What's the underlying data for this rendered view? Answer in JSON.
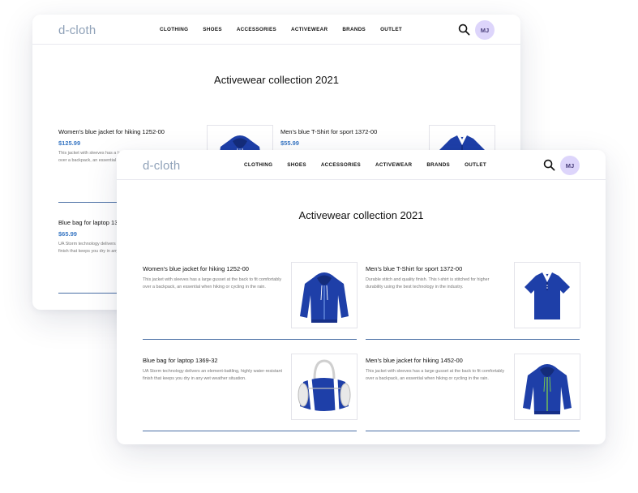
{
  "brand": {
    "logo": "d-cloth"
  },
  "nav": {
    "items": [
      "CLOTHING",
      "SHOES",
      "ACCESSORIES",
      "ACTIVEWEAR",
      "BRANDS",
      "OUTLET"
    ],
    "avatar_initials": "MJ"
  },
  "page_title": "Activewear collection 2021",
  "back_products": [
    {
      "title": "Women's blue jacket for hiking 1252-00",
      "price": "$125.99",
      "description": "This jacket with sleeves has a large gusset at the back to fit comfortably over a backpack, an essential when hiking or cycling in the rain."
    },
    {
      "title": "Men's blue T-Shirt for sport 1372-00",
      "price": "$55.99",
      "description": ""
    },
    {
      "title": "Blue bag for laptop 1369-32",
      "price": "$65.99",
      "description": "UA Storm technology delivers an element-battling, highly water-resistant finish that keeps you dry in any wet weather situation."
    }
  ],
  "front_products": [
    {
      "title": "Women's blue jacket for hiking 1252-00",
      "description": "This jacket with sleeves has a large gusset at the back to fit comfortably over a backpack, an essential when hiking or cycling in the rain.",
      "image_icon": "hoodie-image"
    },
    {
      "title": "Men's blue T-Shirt for sport 1372-00",
      "description": "Durable stitch and quality finish. This t-shirt is stitched for higher durability using the best technology in the industry.",
      "image_icon": "polo-shirt-image"
    },
    {
      "title": "Blue bag for laptop 1369-32",
      "description": "UA Storm technology delivers an element-battling, highly water-resistant finish that keeps you dry in any wet weather situation.",
      "image_icon": "duffel-bag-image"
    },
    {
      "title": "Men's blue jacket for hiking 1452-00",
      "description": "This jacket with sleeves has a large gusset at the back to fit comfortably over a backpack, an essential when hiking or cycling in the rain.",
      "image_icon": "hoodie-image"
    }
  ],
  "colors": {
    "accent": "#3a78c4",
    "logo": "#8fa1b8",
    "avatar_bg": "#ddd5fb",
    "product_blue": "#1e3fa8",
    "divider": "#4a6fa5"
  }
}
